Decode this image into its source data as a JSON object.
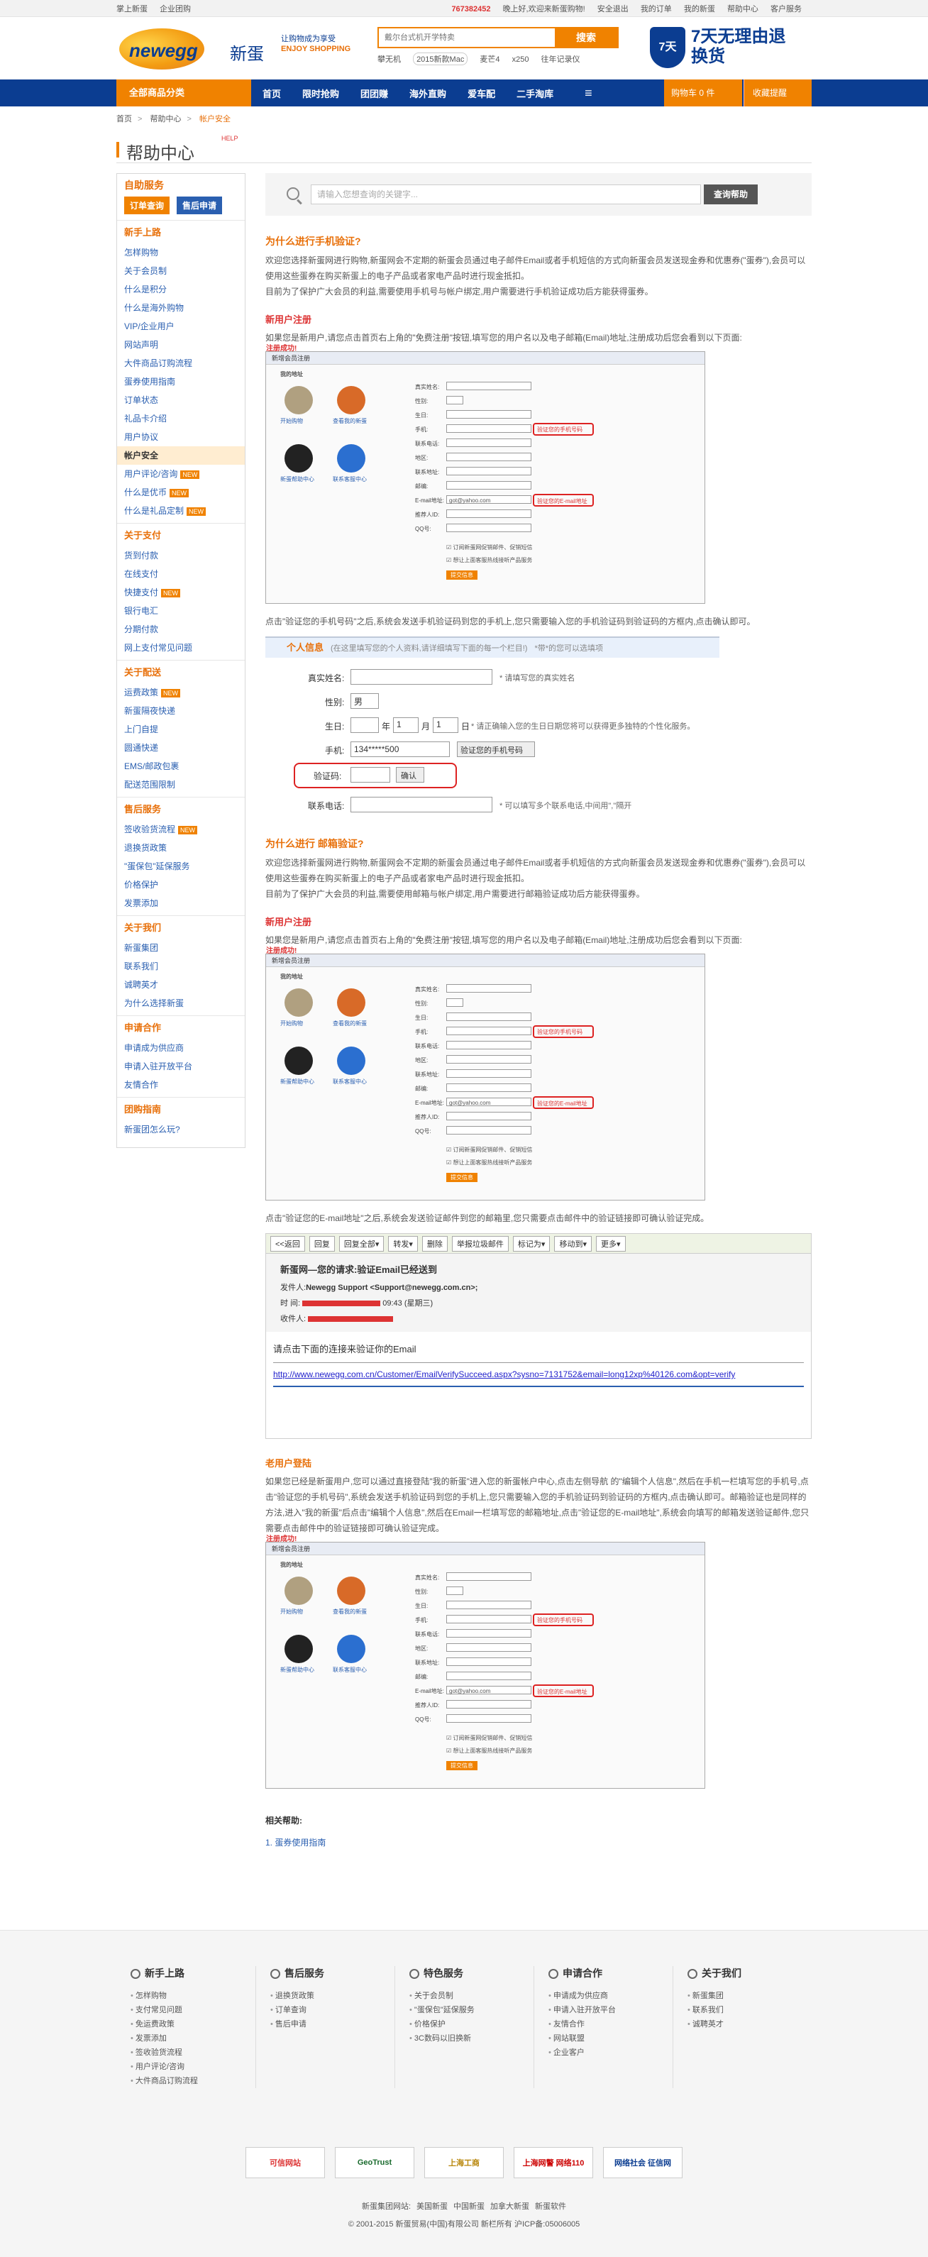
{
  "topbar": {
    "left1": "掌上新蛋",
    "left2": "企业团购",
    "phone": "767382452",
    "welcome": "晚上好,欢迎来新蛋购物!",
    "login": "安全退出",
    "orders": "我的订单",
    "my": "我的新蛋",
    "help": "帮助中心",
    "service": "客户服务"
  },
  "header": {
    "logo": "newegg",
    "logo_cn": "新蛋",
    "slogan1": "让购物成为享受",
    "slogan2": "ENJOY SHOPPING",
    "search_placeholder": "戴尔台式机开学特卖",
    "search_btn": "搜索",
    "hot": [
      "攀无机",
      "2015新款Mac",
      "麦芒4",
      "x250",
      "往年记录仪"
    ],
    "promise": "7天无理由退换货",
    "shield": "7天"
  },
  "nav": {
    "allcat": "全部商品分类",
    "items": [
      "首页",
      "限时抢购",
      "团团赚",
      "海外直购",
      "爱车配",
      "二手淘库"
    ],
    "cart": "购物车  0  件",
    "fav": "收藏提醒"
  },
  "crumb": [
    "首页",
    "帮助中心",
    "帐户安全"
  ],
  "helptitle": "帮助中心",
  "helptitle_tag": "HELP",
  "sidebar": {
    "self": "自助服务",
    "btn1": "订单查询",
    "btn2": "售后申请",
    "sections": [
      {
        "h": "新手上路",
        "items": [
          [
            "怎样购物",
            ""
          ],
          [
            "关于会员制",
            ""
          ],
          [
            "什么是积分",
            ""
          ],
          [
            "什么是海外购物",
            ""
          ],
          [
            "VIP/企业用户",
            ""
          ],
          [
            "网站声明",
            ""
          ],
          [
            "大件商品订购流程",
            ""
          ],
          [
            "蛋券使用指南",
            ""
          ],
          [
            "订单状态",
            ""
          ],
          [
            "礼品卡介绍",
            ""
          ],
          [
            "用户协议",
            ""
          ],
          [
            "帐户安全",
            "on"
          ],
          [
            "用户评论/咨询",
            "tag"
          ],
          [
            "什么是优币",
            "tag"
          ],
          [
            "什么是礼品定制",
            "tag"
          ]
        ]
      },
      {
        "h": "关于支付",
        "items": [
          [
            "货到付款",
            ""
          ],
          [
            "在线支付",
            ""
          ],
          [
            "快捷支付",
            "tag"
          ],
          [
            "银行电汇",
            ""
          ],
          [
            "分期付款",
            ""
          ],
          [
            "网上支付常见问题",
            ""
          ]
        ]
      },
      {
        "h": "关于配送",
        "items": [
          [
            "运费政策",
            "tag"
          ],
          [
            "新蛋隔夜快递",
            ""
          ],
          [
            "上门自提",
            ""
          ],
          [
            "圆通快递",
            ""
          ],
          [
            "EMS/邮政包裹",
            ""
          ],
          [
            "配送范围限制",
            ""
          ]
        ]
      },
      {
        "h": "售后服务",
        "items": [
          [
            "签收验货流程",
            "tag"
          ],
          [
            "退换货政策",
            ""
          ],
          [
            "\"蛋保包\"延保服务",
            ""
          ],
          [
            "价格保护",
            ""
          ],
          [
            "发票添加",
            ""
          ]
        ]
      },
      {
        "h": "关于我们",
        "items": [
          [
            "新蛋集团",
            ""
          ],
          [
            "联系我们",
            ""
          ],
          [
            "诚聘英才",
            ""
          ],
          [
            "为什么选择新蛋",
            ""
          ]
        ]
      },
      {
        "h": "申请合作",
        "items": [
          [
            "申请成为供应商",
            ""
          ],
          [
            "申请入驻开放平台",
            ""
          ],
          [
            "友情合作",
            ""
          ]
        ]
      },
      {
        "h": "团购指南",
        "items": [
          [
            "新蛋团怎么玩?",
            ""
          ]
        ]
      }
    ]
  },
  "searchbox": {
    "placeholder": "请输入您想查询的关键字...",
    "btn": "查询帮助"
  },
  "phone_q": "为什么进行手机验证?",
  "phone_p1": "欢迎您选择新蛋网进行购物,新蛋网会不定期的新蛋会员通过电子邮件Email或者手机短信的方式向新蛋会员发送现金券和优惠券(\"蛋券\"),会员可以使用这些蛋券在购买新蛋上的电子产品或者家电产品时进行现金抵扣。",
  "phone_p2": "目前为了保护广大会员的利益,需要使用手机号与帐户绑定,用户需要进行手机验证成功后方能获得蛋券。",
  "new_user": "新用户注册",
  "new_user_p": "如果您是新用户,请您点击首页右上角的\"免费注册\"按钮,填写您的用户名以及电子邮箱(Email)地址,注册成功后您会看到以下页面:",
  "reg_ok": "注册成功!",
  "phone_step": "点击\"验证您的手机号码\"之后,系统会发送手机验证码到您的手机上,您只需要输入您的手机验证码到验证码的方框内,点击确认即可。",
  "form": {
    "title": "个人信息",
    "title_note": "(在这里填写您的个人资料,请详细填写下面的每一个栏目!)",
    "title_star": "*带*的您可以选填项",
    "name": "真实姓名:",
    "name_note": "* 请填写您的真实姓名",
    "gender": "性别:",
    "gender_val": "男",
    "birth": "生日:",
    "birth_note": "* 请正确输入您的生日日期您将可以获得更多独特的个性化服务。",
    "year": "年",
    "month": "月",
    "day": "日",
    "mon_val": "1",
    "day_val": "1",
    "phone": "手机:",
    "phone_val": "134*****500",
    "phone_btn": "验证您的手机号码",
    "code": "验证码:",
    "code_btn": "确认",
    "tel": "联系电话:",
    "tel_note": "* 可以填写多个联系电话,中间用\",\"隔开"
  },
  "email_q": "为什么进行 邮箱验证?",
  "email_p1": "欢迎您选择新蛋网进行购物,新蛋网会不定期的新蛋会员通过电子邮件Email或者手机短信的方式向新蛋会员发送现金券和优惠券(\"蛋券\"),会员可以使用这些蛋券在购买新蛋上的电子产品或者家电产品时进行现金抵扣。",
  "email_p2": "目前为了保护广大会员的利益,需要使用邮箱与帐户绑定,用户需要进行邮箱验证成功后方能获得蛋券。",
  "email_step": "点击\"验证您的E-mail地址\"之后,系统会发送验证邮件到您的邮箱里,您只需要点击邮件中的验证链接即可确认验证完成。",
  "mail": {
    "tools": [
      "<<返回",
      "回复",
      "回复全部▾",
      "转发▾",
      "删除",
      "举报垃圾邮件",
      "标记为▾",
      "移动到▾",
      "更多▾"
    ],
    "subject": "新蛋网—您的请求:验证Email已经送到",
    "from_l": "发件人:",
    "from": "Newegg Support <Support@newegg.com.cn>;",
    "time_l": "时 间:",
    "time": "09:43 (星期三)",
    "to_l": "收件人:",
    "b1": "请点击下面的连接来验证你的Email",
    "link": "http://www.newegg.com.cn/Customer/EmailVerifySucceed.aspx?sysno=7131752&email=long12xp%40126.com&opt=verify"
  },
  "old_user": "老用户登陆",
  "old_p": "如果您已经是新蛋用户,您可以通过直接登陆\"我的新蛋\"进入您的新蛋帐户中心,点击左侧导航 的\"编辑个人信息\",然后在手机一栏填写您的手机号,点击\"验证您的手机号码\",系统会发送手机验证码到您的手机上,您只需要输入您的手机验证码到验证码的方框内,点击确认即可。邮箱验证也是同样的方法,进入\"我的新蛋\"后点击\"编辑个人信息\",然后在Email一栏填写您的邮箱地址,点击\"验证您的E-mail地址\",系统会向填写的邮箱发送验证邮件,您只需要点击邮件中的验证链接即可确认验证完成。",
  "related": "相关帮助:",
  "related_link": "1. 蛋券使用指南",
  "shot": {
    "title": "新增会员注册",
    "f1": "真实姓名:",
    "f2": "性别:",
    "f3": "生日:",
    "f4": "手机:",
    "f5": "联系电话:",
    "f6": "地区:",
    "f7": "联系地址:",
    "f8": "邮编:",
    "f9": "E-mail地址:",
    "f10": "推荐人ID:",
    "f11": "QQ号:",
    "verify_phone": "验证您的手机号码",
    "verify_mail": "验证您的E-mail地址",
    "email": "got@yahoo.com",
    "submit": "提交信息",
    "opt1": "订阅新蛋网促销邮件、促销短信",
    "opt2": "想让上面客服热线接听产品服务",
    "mine": "我的地址",
    "addr": "请选择省份",
    "c1": "开始购物",
    "c2": "查看我的新蛋",
    "c3": "新蛋帮助中心",
    "c4": "联系客服中心"
  },
  "footer": {
    "cols": [
      {
        "h": "新手上路",
        "items": [
          "怎样购物",
          "支付常见问题",
          "免运费政策",
          "发票添加",
          "签收验货流程",
          "用户评论/咨询",
          "大件商品订购流程"
        ]
      },
      {
        "h": "售后服务",
        "items": [
          "退换货政策",
          "订单查询",
          "售后申请"
        ]
      },
      {
        "h": "特色服务",
        "items": [
          "关于会员制",
          "\"蛋保包\"延保服务",
          "价格保护",
          "3C数码以旧换新"
        ]
      },
      {
        "h": "申请合作",
        "items": [
          "申请成为供应商",
          "申请入驻开放平台",
          "友情合作",
          "网站联盟",
          "企业客户"
        ]
      },
      {
        "h": "关于我们",
        "items": [
          "新蛋集团",
          "联系我们",
          "诚聘英才"
        ]
      }
    ],
    "certs": [
      "可信网站",
      "GeoTrust",
      "上海工商",
      "上海网警 网络110",
      "网络社会 征信网"
    ],
    "links": [
      "新蛋集团网站:",
      "美国新蛋",
      "中国新蛋",
      "加拿大新蛋",
      "新蛋软件"
    ],
    "copy": "© 2001-2015 新蛋贸易(中国)有限公司 新栏所有 沪ICP备:05006005"
  }
}
